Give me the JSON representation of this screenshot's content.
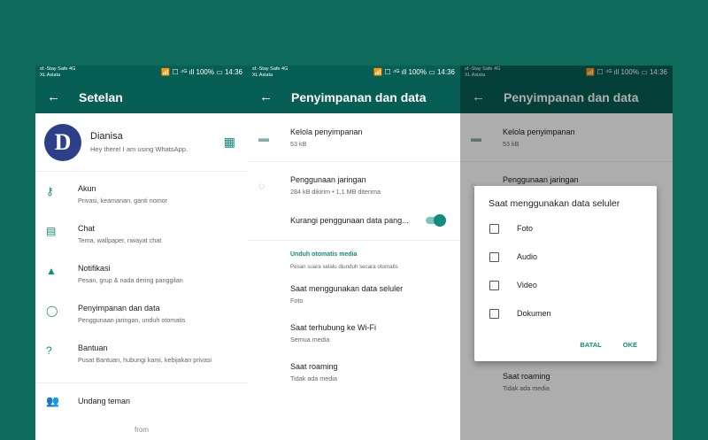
{
  "status": {
    "carrier1": "sf.-Stay Safe 4G",
    "carrier2": "XL Axiata",
    "right": "📶 ☐ ⁴ᴳ ıll 100% ▭ 14:36"
  },
  "screen1": {
    "title": "Setelan",
    "profile": {
      "initial": "D",
      "name": "Dianisa",
      "status": "Hey there! I am using WhatsApp."
    },
    "items": [
      {
        "title": "Akun",
        "sub": "Privasi, keamanan, ganti nomor",
        "icon": "key-icon"
      },
      {
        "title": "Chat",
        "sub": "Tema, wallpaper, riwayat chat",
        "icon": "chat-icon"
      },
      {
        "title": "Notifikasi",
        "sub": "Pesan, grup & nada dering panggilan",
        "icon": "bell-icon"
      },
      {
        "title": "Penyimpanan dan data",
        "sub": "Penggunaan jaringan, unduh otomatis",
        "icon": "storage-circle-icon"
      },
      {
        "title": "Bantuan",
        "sub": "Pusat Bantuan, hubungi kami, kebijakan privasi",
        "icon": "help-icon"
      }
    ],
    "invite": "Undang teman",
    "from": "from"
  },
  "screen2": {
    "title": "Penyimpanan dan data",
    "manage_title": "Kelola penyimpanan",
    "manage_sub": "53 kB",
    "network_title": "Penggunaan jaringan",
    "network_sub": "284 kB dikirim • 1,1 MB diterima",
    "reduce": "Kurangi penggunaan data pang...",
    "auto_label": "Unduh otomatis media",
    "auto_sub": "Pesan suara selalu diunduh secara otomatis",
    "mobile_title": "Saat menggunakan data seluler",
    "mobile_sub": "Foto",
    "wifi_title": "Saat terhubung ke Wi-Fi",
    "wifi_sub": "Semua media",
    "roaming_title": "Saat roaming",
    "roaming_sub": "Tidak ada media"
  },
  "screen3": {
    "title": "Penyimpanan dan data",
    "manage_title": "Kelola penyimpanan",
    "manage_sub": "53 kB",
    "network_title": "Penggunaan jaringan",
    "roaming_title": "Saat roaming",
    "roaming_sub": "Tidak ada media",
    "dialog": {
      "title": "Saat menggunakan data seluler",
      "options": [
        "Foto",
        "Audio",
        "Video",
        "Dokumen"
      ],
      "cancel": "BATAL",
      "ok": "OKE"
    }
  },
  "colors": {
    "header": "#075e54",
    "accent": "#128c7e",
    "background": "#0e6b5c"
  }
}
